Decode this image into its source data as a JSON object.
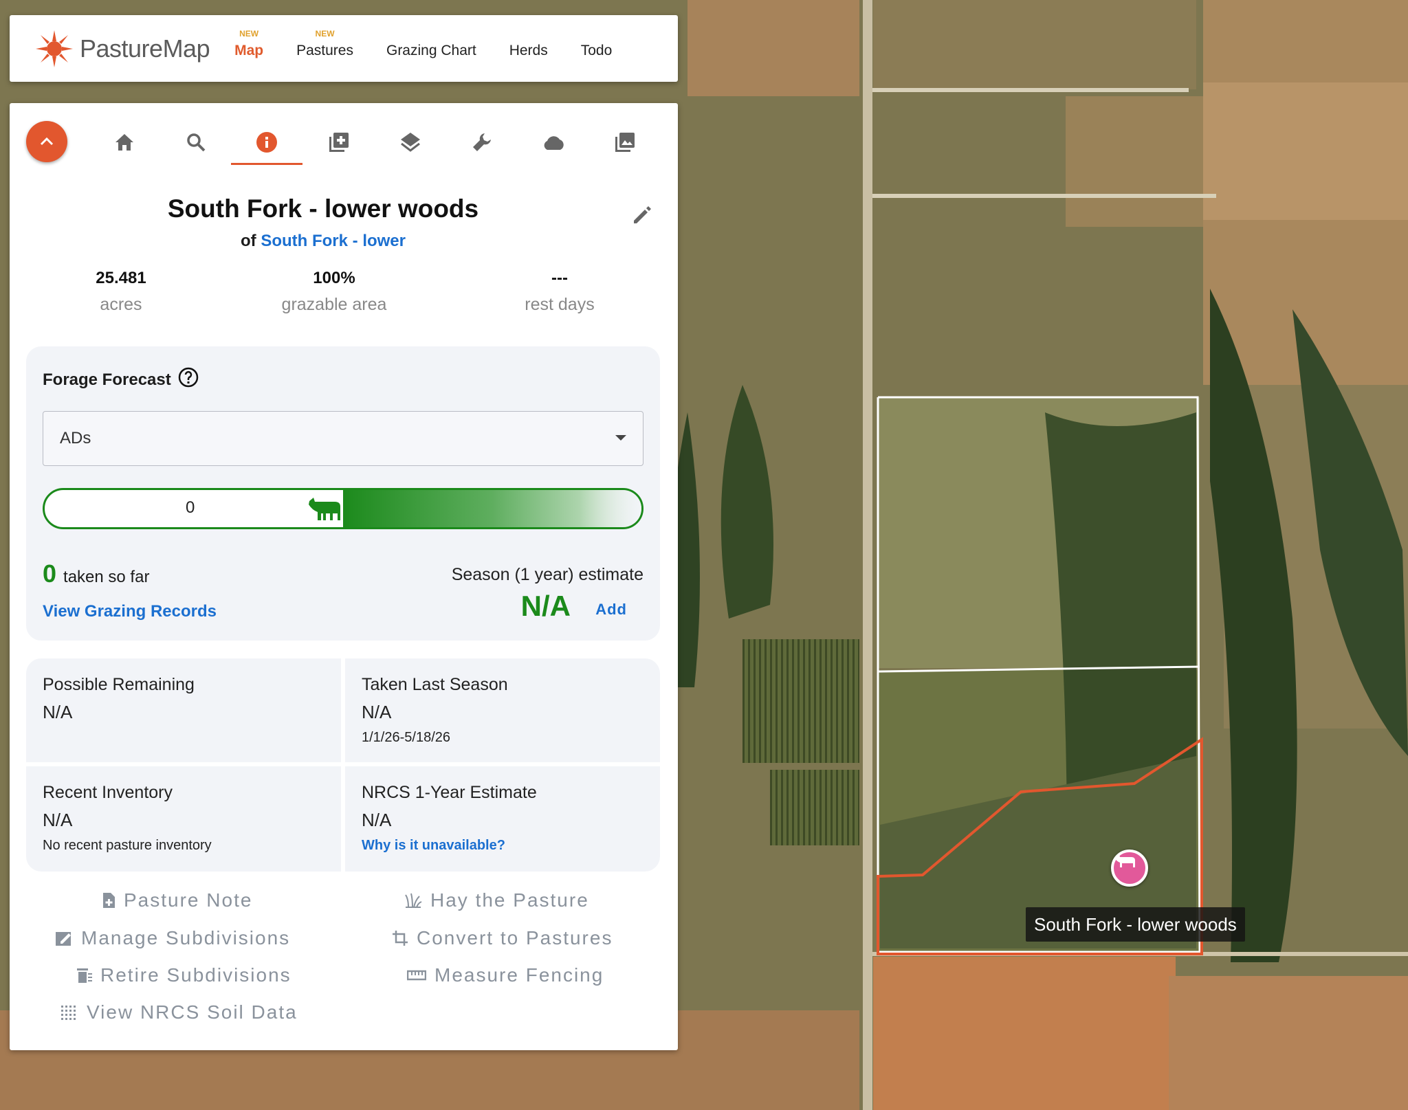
{
  "brand": {
    "name": "PastureMap",
    "accent": "#e2572e"
  },
  "nav": {
    "items": [
      {
        "label": "Map",
        "badge": "NEW"
      },
      {
        "label": "Pastures",
        "badge": "NEW"
      },
      {
        "label": "Grazing Chart",
        "badge": ""
      },
      {
        "label": "Herds",
        "badge": ""
      },
      {
        "label": "Todo",
        "badge": ""
      }
    ]
  },
  "toolbar": {
    "icons": [
      "home-icon",
      "search-icon",
      "info-icon",
      "add-box-icon",
      "layers-icon",
      "wrench-icon",
      "cloud-icon",
      "photo-library-icon"
    ],
    "active": "info-icon"
  },
  "pasture": {
    "title": "South Fork - lower woods",
    "of_label": "of",
    "parent": "South Fork - lower"
  },
  "stats": [
    {
      "value": "25.481",
      "label": "acres"
    },
    {
      "value": "100%",
      "label": "grazable area"
    },
    {
      "value": "---",
      "label": "rest days"
    }
  ],
  "forecast": {
    "title": "Forage Forecast",
    "select_value": "ADs",
    "slider_value": "0",
    "taken_value": "0",
    "taken_label": "taken so far",
    "records_link": "View Grazing Records",
    "season_label": "Season (1 year) estimate",
    "season_value": "N/A",
    "add_label": "Add"
  },
  "cards": {
    "possible_remaining": {
      "title": "Possible Remaining",
      "value": "N/A"
    },
    "taken_last_season": {
      "title": "Taken Last Season",
      "value": "N/A",
      "range": "1/1/26-5/18/26"
    },
    "recent_inventory": {
      "title": "Recent Inventory",
      "value": "N/A",
      "note": "No recent pasture inventory"
    },
    "nrcs_estimate": {
      "title": "NRCS 1-Year Estimate",
      "value": "N/A",
      "link": "Why is it unavailable?"
    }
  },
  "actions": {
    "pasture_note": "Pasture Note",
    "hay_pasture": "Hay the Pasture",
    "manage_subdivisions": "Manage Subdivisions",
    "convert_pastures": "Convert to Pastures",
    "retire_subdivisions": "Retire Subdivisions",
    "measure_fencing": "Measure Fencing",
    "view_soil": "View NRCS Soil Data"
  },
  "map": {
    "label": "South Fork - lower woods",
    "boundary_color": "#e2572e",
    "marker_color": "#e2599a"
  }
}
